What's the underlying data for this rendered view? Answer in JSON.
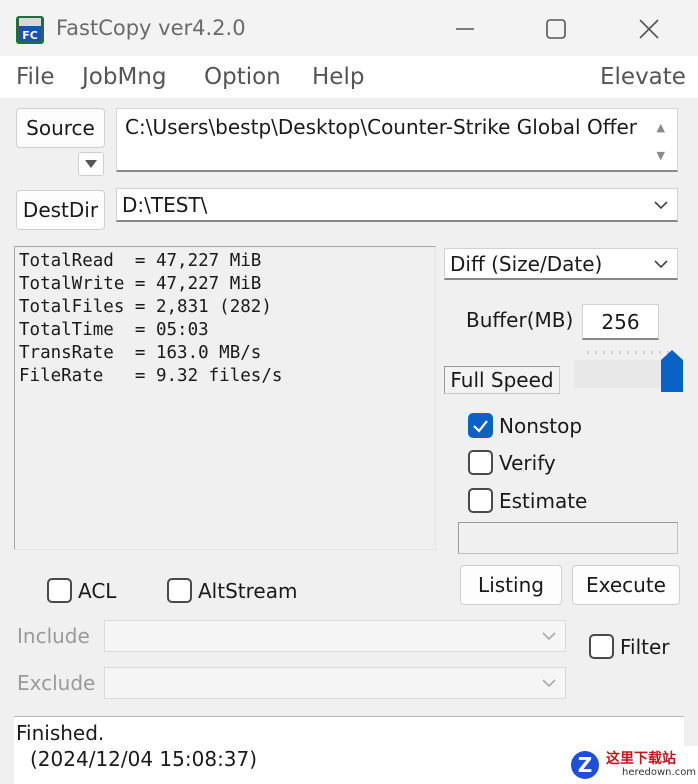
{
  "window": {
    "title": "FastCopy ver4.2.0",
    "icon_label": "FC"
  },
  "menu": {
    "items": [
      "File",
      "JobMng",
      "Option",
      "Help"
    ],
    "elevate": "Elevate"
  },
  "source": {
    "button_label": "Source",
    "path": "C:\\Users\\bestp\\Desktop\\Counter-Strike Global Offensiv"
  },
  "dest": {
    "button_label": "DestDir",
    "path": "D:\\TEST\\"
  },
  "stats": [
    "TotalRead  = 47,227 MiB",
    "TotalWrite = 47,227 MiB",
    "TotalFiles = 2,831 (282)",
    "TotalTime  = 05:03",
    "TransRate  = 163.0 MB/s",
    "FileRate   = 9.32 files/s"
  ],
  "mode": {
    "selected": "Diff (Size/Date)"
  },
  "buffer": {
    "label": "Buffer(MB)",
    "value": "256"
  },
  "speed": {
    "label": "Full Speed",
    "level_fraction": 1.0
  },
  "options": {
    "nonstop": {
      "label": "Nonstop",
      "checked": true
    },
    "verify": {
      "label": "Verify",
      "checked": false
    },
    "estimate": {
      "label": "Estimate",
      "checked": false
    },
    "acl": {
      "label": "ACL",
      "checked": false
    },
    "altstream": {
      "label": "AltStream",
      "checked": false
    },
    "filter": {
      "label": "Filter",
      "checked": false
    }
  },
  "actions": {
    "listing": "Listing",
    "execute": "Execute"
  },
  "filters": {
    "include_label": "Include",
    "exclude_label": "Exclude"
  },
  "log": {
    "line1": "Finished.",
    "line2": "(2024/12/04 15:08:37)"
  },
  "watermark": {
    "text": "这里下载站",
    "url": "heredown.com"
  },
  "colors": {
    "accent": "#0a62c5",
    "window_bg": "#f0f0f0",
    "disabled_text": "#9a9a9a"
  }
}
